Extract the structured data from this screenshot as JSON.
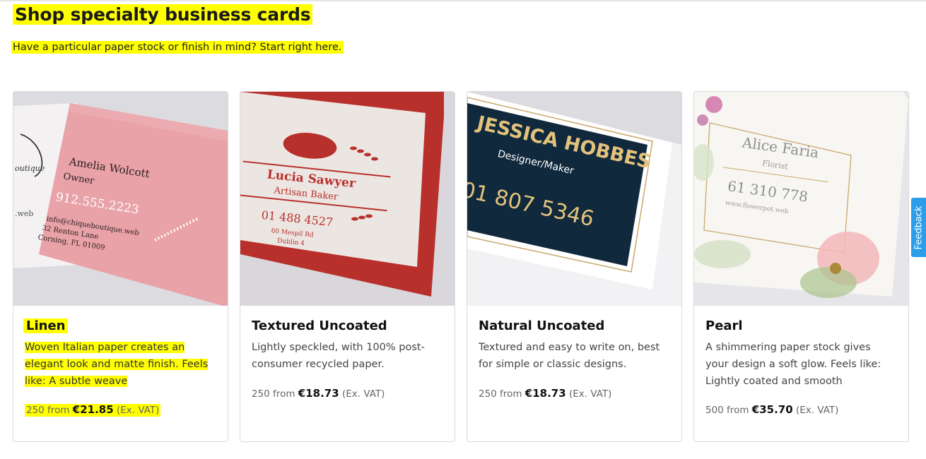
{
  "header": {
    "title": "Shop specialty business cards",
    "subtitle": "Have a particular paper stock or finish in mind? Start right here."
  },
  "cards": [
    {
      "title": "Linen",
      "description": "Woven Italian paper creates an elegant look and matte finish. Feels like: A subtle weave",
      "qty_from": "250 from",
      "price": "€21.85",
      "vat": "(Ex. VAT)",
      "sample": {
        "brand": "outique",
        "name": "Amelia Wolcott",
        "role": "Owner",
        "phone": "912.555.2223",
        "web": ".web",
        "email": "info@chiqueboutique.web",
        "addr1": "32 Renton Lane",
        "addr2": "Corning, FL 01009"
      }
    },
    {
      "title": "Textured Uncoated",
      "description": "Lightly speckled, with 100% post-consumer recycled paper.",
      "qty_from": "250 from",
      "price": "€18.73",
      "vat": "(Ex. VAT)",
      "sample": {
        "name": "Lucia Sawyer",
        "role": "Artisan Baker",
        "phone": "01 488 4527",
        "addr1": "60 Mespil Rd",
        "addr2": "Dublin 4"
      }
    },
    {
      "title": "Natural Uncoated",
      "description": "Textured and easy to write on, best for simple or classic designs.",
      "qty_from": "250 from",
      "price": "€18.73",
      "vat": "(Ex. VAT)",
      "sample": {
        "name": "JESSICA HOBBES",
        "role": "Designer/Maker",
        "phone": "01 807 5346"
      }
    },
    {
      "title": "Pearl",
      "description": "A shimmering paper stock gives your design a soft glow. Feels like: Lightly coated and smooth",
      "qty_from": "500 from",
      "price": "€35.70",
      "vat": "(Ex. VAT)",
      "sample": {
        "name": "Alice Faria",
        "role": "Florist",
        "phone": "61 310 778",
        "web": "www.flowerpot.web"
      }
    }
  ],
  "feedback": {
    "label": "Feedback"
  },
  "colors": {
    "highlight": "#ffff00",
    "feedback": "#2b9de9",
    "linen_card": "#e8a2a8",
    "textured_card": "#b8302c",
    "natural_card": "#10293d"
  },
  "icons": {
    "wheat": "wheat-icon",
    "bread": "bread-icon",
    "flower": "flower-icon"
  }
}
